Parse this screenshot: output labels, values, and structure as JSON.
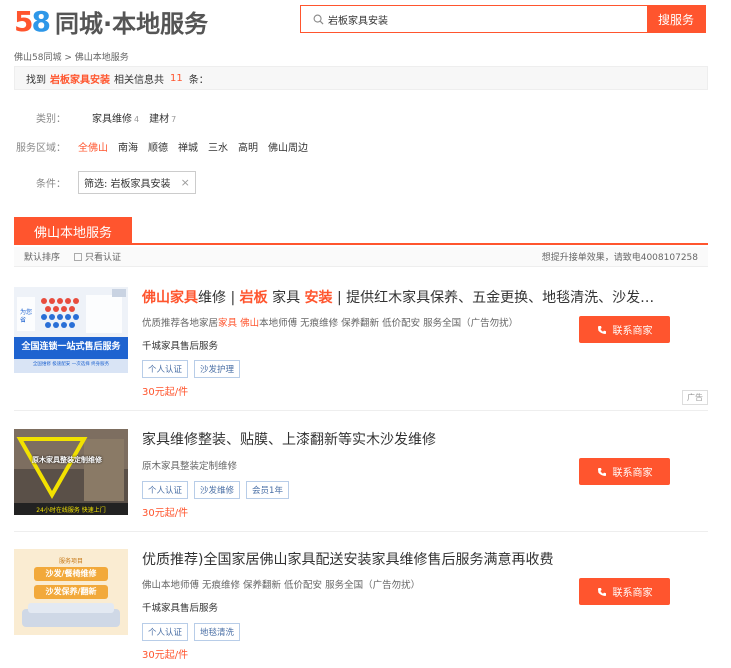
{
  "header": {
    "logo_number_5": "5",
    "logo_number_8": "8",
    "logo_text": "同城·本地服务",
    "search_value": "岩板家具安装",
    "search_button": "搜服务"
  },
  "breadcrumb": "佛山58同城 > 佛山本地服务",
  "found": {
    "prefix": "找到",
    "keyword": "岩板家具安装",
    "middle": "相关信息共",
    "count": "11",
    "suffix": "条："
  },
  "filters": {
    "category_label": "类别：",
    "categories": [
      {
        "label": "家具维修",
        "count": "4"
      },
      {
        "label": "建材",
        "count": "7"
      }
    ],
    "area_label": "服务区域：",
    "areas": [
      "全佛山",
      "南海",
      "顺德",
      "禅城",
      "三水",
      "高明",
      "佛山周边"
    ],
    "condition_label": "条件：",
    "condition_chip": "筛选: 岩板家具安装",
    "condition_close": "×"
  },
  "tab": "佛山本地服务",
  "sortbar": {
    "default_sort": "默认排序",
    "personal_only": "只看认证",
    "promo": "想提升接单效果，请致电4008107258"
  },
  "listings": [
    {
      "title_parts": [
        {
          "t": "佛山家具",
          "hl": true
        },
        {
          "t": "维修 | ",
          "hl": false
        },
        {
          "t": "岩板",
          "hl": true
        },
        {
          "t": " 家具 ",
          "hl": false
        },
        {
          "t": "安装",
          "hl": true
        },
        {
          "t": " | 提供红木家具保养、五金更换、地毯清洗、沙发…",
          "hl": false
        }
      ],
      "desc_parts": [
        {
          "t": "优质推荐各地家居",
          "hl": false
        },
        {
          "t": "家具",
          "hl": true
        },
        {
          "t": " ",
          "hl": false
        },
        {
          "t": "佛山",
          "hl": true
        },
        {
          "t": "本地师傅 无痕维修 保养翻新 低价配安 服务全国（广告勿扰）",
          "hl": false
        }
      ],
      "shop": "千城家具售后服务",
      "tags": [
        "个人认证",
        "沙发护理"
      ],
      "price": "30元起/件",
      "contact": "联系商家",
      "ad": "广告",
      "thumb_lines": [
        "全国连锁一站式售后服务",
        "全国维修 极速配安 一次选择 终身服务"
      ],
      "thumb_side": "为您省"
    },
    {
      "title_parts": [
        {
          "t": "家具维修整装、贴膜、上漆翻新等实木沙发维修",
          "hl": false
        }
      ],
      "desc_parts": [
        {
          "t": "原木家具整装定制维修",
          "hl": false
        }
      ],
      "tags": [
        "个人认证",
        "沙发维修",
        "会员1年"
      ],
      "price": "30元起/件",
      "contact": "联系商家",
      "thumb_lines": [
        "原木家具整装定制维修",
        "24小时在线服务 快速上门"
      ]
    },
    {
      "title_parts": [
        {
          "t": "优质推荐)全国家居佛山家具配送安装家具维修售后服务满意再收费",
          "hl": false
        }
      ],
      "desc_parts": [
        {
          "t": "佛山本地师傅 无痕维修 保养翻新 低价配安 服务全国（广告勿扰）",
          "hl": false
        }
      ],
      "shop": "千城家具售后服务",
      "tags": [
        "个人认证",
        "地毯清洗"
      ],
      "price": "30元起/件",
      "contact": "联系商家",
      "thumb_lines": [
        "服务项目",
        "沙发/餐椅维修",
        "沙发保养/翻新"
      ]
    }
  ]
}
